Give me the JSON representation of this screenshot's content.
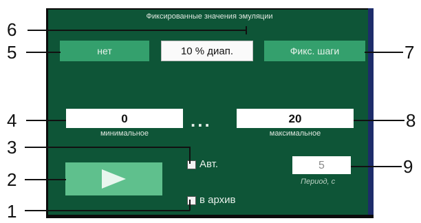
{
  "panel": {
    "title": "Фиксированные значения эмуляции",
    "buttons": {
      "none_label": "нет",
      "range_label": "10 % диап.",
      "steps_label": "Фикс. шаги"
    },
    "min": {
      "value": "0",
      "label": "минимальное"
    },
    "separator": "...",
    "max": {
      "value": "20",
      "label": "максимальное"
    },
    "auto_checkbox_label": "Авт.",
    "archive_checkbox_label": "в архив",
    "period": {
      "value": "5",
      "label": "Период, с"
    }
  },
  "callouts": [
    "1",
    "2",
    "3",
    "4",
    "5",
    "6",
    "7",
    "8",
    "9"
  ],
  "colors": {
    "panel_bg": "#0e5537",
    "button_green": "#34a06d",
    "play_green": "#5fc08d",
    "edge_blue": "#1d2c6a"
  },
  "icons": {
    "play": "play-icon"
  }
}
